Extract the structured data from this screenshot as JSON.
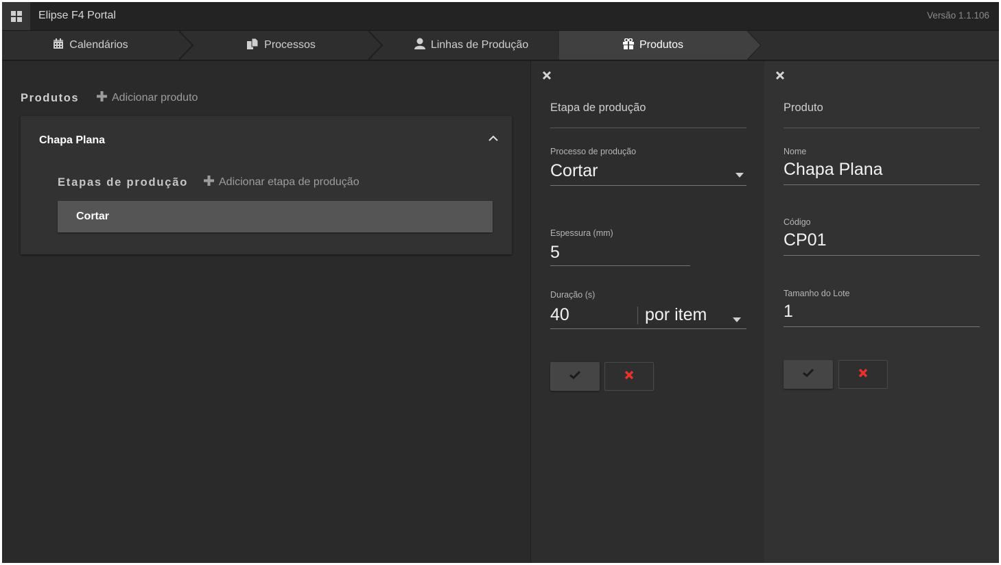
{
  "app": {
    "title": "Elipse F4 Portal",
    "version": "Versão 1.1.106",
    "icon": "grid-icon"
  },
  "tabs": [
    {
      "label": "Calendários",
      "icon": "calendar-icon",
      "active": false
    },
    {
      "label": "Processos",
      "icon": "documents-icon",
      "active": false
    },
    {
      "label": "Linhas de Produção",
      "icon": "user-icon",
      "active": false
    },
    {
      "label": "Produtos",
      "icon": "gift-icon",
      "active": true
    }
  ],
  "products_panel": {
    "title": "Produtos",
    "add_label": "Adicionar produto",
    "product": {
      "name": "Chapa Plana",
      "steps_title": "Etapas de produção",
      "add_step_label": "Adicionar etapa de produção",
      "steps": [
        "Cortar"
      ]
    }
  },
  "step_panel": {
    "heading": "Etapa de produção",
    "process_label": "Processo de produção",
    "process_value": "Cortar",
    "thickness_label": "Espessura (mm)",
    "thickness_value": "5",
    "duration_label": "Duração (s)",
    "duration_value": "40",
    "duration_unit": "por item"
  },
  "product_panel": {
    "heading": "Produto",
    "name_label": "Nome",
    "name_value": "Chapa Plana",
    "code_label": "Código",
    "code_value": "CP01",
    "batch_label": "Tamanho do Lote",
    "batch_value": "1"
  },
  "colors": {
    "background": "#2b2b2b",
    "active_tab": "#404040",
    "cancel_red": "#e8322c"
  }
}
